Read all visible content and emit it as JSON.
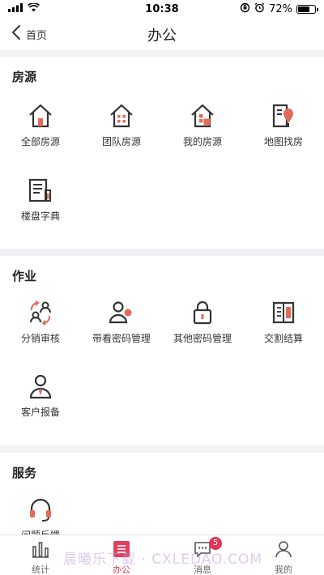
{
  "status_bar": {
    "time": "10:38",
    "battery": "72%",
    "battery_level": 0.72
  },
  "header": {
    "back_label": "首页",
    "title": "办公"
  },
  "sections": {
    "housing": {
      "title": "房源",
      "items": [
        {
          "label": "全部房源",
          "icon": "house-icon"
        },
        {
          "label": "团队房源",
          "icon": "team-house-icon"
        },
        {
          "label": "我的房源",
          "icon": "my-house-icon"
        },
        {
          "label": "地图找房",
          "icon": "map-pin-building-icon"
        },
        {
          "label": "楼盘字典",
          "icon": "building-dictionary-icon"
        }
      ]
    },
    "work": {
      "title": "作业",
      "items": [
        {
          "label": "分销审核",
          "icon": "user-exchange-icon"
        },
        {
          "label": "带看密码管理",
          "icon": "user-group-icon"
        },
        {
          "label": "其他密码管理",
          "icon": "lock-icon"
        },
        {
          "label": "交割结算",
          "icon": "ledger-book-icon"
        },
        {
          "label": "客户报备",
          "icon": "customer-report-icon"
        }
      ]
    },
    "service": {
      "title": "服务",
      "items": [
        {
          "label": "问题反馈",
          "icon": "headset-icon"
        }
      ]
    }
  },
  "tabbar": {
    "items": [
      {
        "label": "统计",
        "icon": "bar-chart-icon"
      },
      {
        "label": "办公",
        "icon": "office-icon"
      },
      {
        "label": "消息",
        "icon": "chat-icon",
        "badge": "5"
      },
      {
        "label": "我的",
        "icon": "profile-icon"
      }
    ]
  },
  "watermark": "晨曦乐下载 · CXLEDAO.COM",
  "colors": {
    "accent": "#e0405e",
    "icon_dark": "#333333",
    "icon_accent": "#e26b5a"
  }
}
